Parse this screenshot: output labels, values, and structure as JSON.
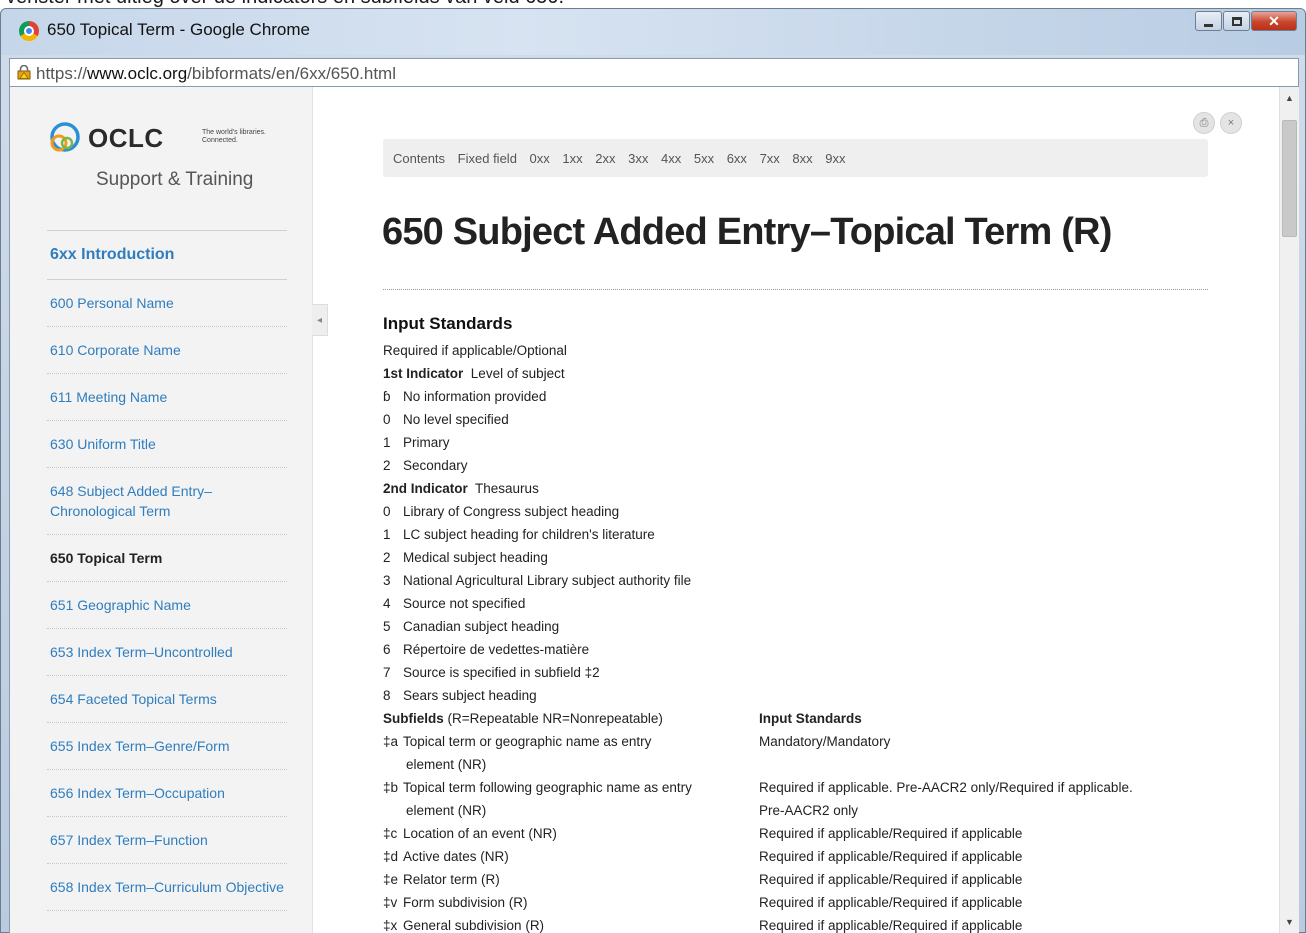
{
  "caption": "venster met uitleg over de indicators en subfields van veld 650.",
  "window": {
    "title": "650 Topical Term - Google Chrome",
    "url_prefix": "https://",
    "url_host": "www.oclc.org",
    "url_path": "/bibformats/en/6xx/650.html"
  },
  "brand": {
    "name": "OCLC",
    "tagline": "The world's libraries. Connected.",
    "subtitle": "Support & Training"
  },
  "sidebar": {
    "intro": "6xx Introduction",
    "items": [
      "600 Personal Name",
      "610 Corporate Name",
      "611 Meeting Name",
      "630 Uniform Title",
      "648 Subject Added Entry–Chronological Term",
      "650 Topical Term",
      "651 Geographic Name",
      "653 Index Term–Uncontrolled",
      "654 Faceted Topical Terms",
      "655 Index Term–Genre/Form",
      "656 Index Term–Occupation",
      "657 Index Term–Function",
      "658 Index Term–Curriculum Objective"
    ]
  },
  "topnav": [
    "Contents",
    "Fixed field",
    "0xx",
    "1xx",
    "2xx",
    "3xx",
    "4xx",
    "5xx",
    "6xx",
    "7xx",
    "8xx",
    "9xx"
  ],
  "page_title": "650 Subject Added Entry–Topical Term (R)",
  "input_standards": {
    "heading": "Input Standards",
    "requirement": "Required if applicable/Optional",
    "ind1_label": "1st Indicator",
    "ind1_desc": "Level of subject",
    "ind1_values": [
      {
        "code": "ɓ",
        "text": "No information provided"
      },
      {
        "code": "0",
        "text": "No level specified"
      },
      {
        "code": "1",
        "text": "Primary"
      },
      {
        "code": "2",
        "text": "Secondary"
      }
    ],
    "ind2_label": "2nd Indicator",
    "ind2_desc": "Thesaurus",
    "ind2_values": [
      {
        "code": "0",
        "text": "Library of Congress subject heading"
      },
      {
        "code": "1",
        "text": "LC subject heading for children's literature"
      },
      {
        "code": "2",
        "text": "Medical subject heading"
      },
      {
        "code": "3",
        "text": "National Agricultural Library subject authority file"
      },
      {
        "code": "4",
        "text": "Source not specified"
      },
      {
        "code": "5",
        "text": "Canadian subject heading"
      },
      {
        "code": "6",
        "text": "Répertoire de vedettes-matière"
      },
      {
        "code": "7",
        "text": "Source is specified in subfield ‡2"
      },
      {
        "code": "8",
        "text": "Sears subject heading"
      }
    ],
    "subfields_label": "Subfields",
    "subfields_note": "(R=Repeatable  NR=Nonrepeatable)",
    "subfields_std_header": "Input Standards",
    "subfields": [
      {
        "code": "‡a",
        "l1": "Topical term or geographic name as entry",
        "l2": "element (NR)",
        "s1": "Mandatory/Mandatory",
        "s2": ""
      },
      {
        "code": "‡b",
        "l1": "Topical term following geographic name as entry",
        "l2": "element (NR)",
        "s1": "Required if applicable. Pre-AACR2 only/Required if applicable.",
        "s2": "Pre-AACR2 only"
      },
      {
        "code": "‡c",
        "l1": "Location of an event (NR)",
        "l2": "",
        "s1": "Required if applicable/Required if applicable",
        "s2": ""
      },
      {
        "code": "‡d",
        "l1": "Active dates (NR)",
        "l2": "",
        "s1": "Required if applicable/Required if applicable",
        "s2": ""
      },
      {
        "code": "‡e",
        "l1": "Relator term (R)",
        "l2": "",
        "s1": "Required if applicable/Required if applicable",
        "s2": ""
      },
      {
        "code": "‡v",
        "l1": "Form subdivision (R)",
        "l2": "",
        "s1": "Required if applicable/Required if applicable",
        "s2": ""
      },
      {
        "code": "‡x",
        "l1": "General subdivision (R)",
        "l2": "",
        "s1": "Required if applicable/Required if applicable",
        "s2": ""
      }
    ]
  },
  "colors": {
    "link": "#2f7dbe",
    "sidebar_bg": "#f3f3f3",
    "close_button": "#c9442b"
  }
}
